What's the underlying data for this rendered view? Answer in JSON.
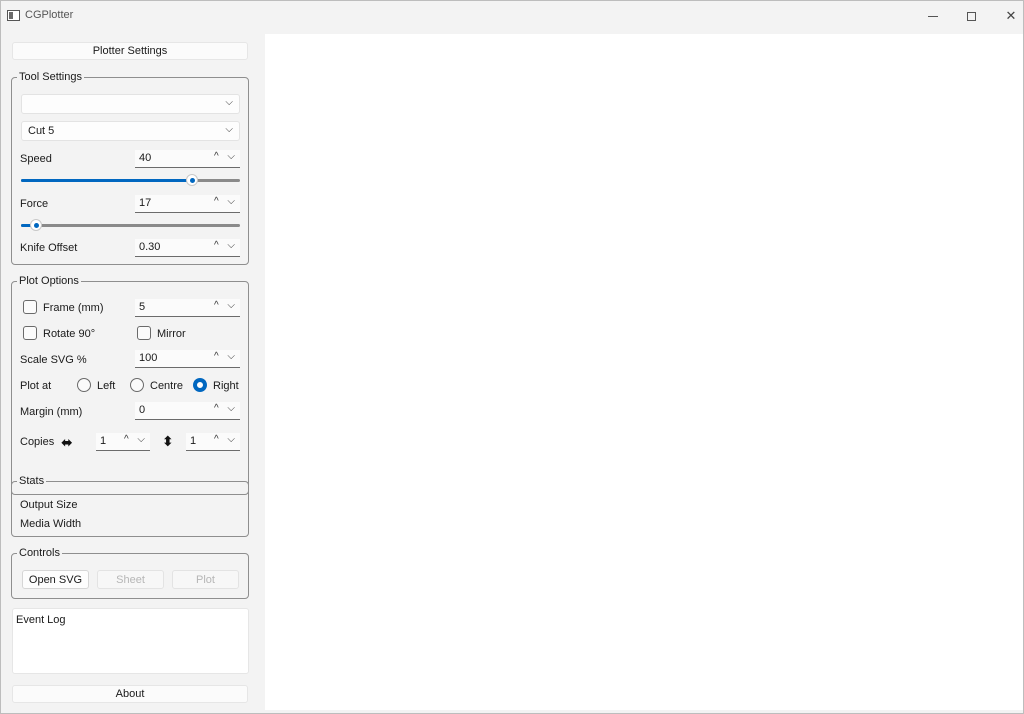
{
  "window": {
    "title": "CGPlotter"
  },
  "plotter_settings_button": "Plotter Settings",
  "tool_settings": {
    "title": "Tool Settings",
    "tool_combo": "",
    "cut_combo": "Cut 5",
    "speed": {
      "label": "Speed",
      "value": "40",
      "level": 0.78
    },
    "force": {
      "label": "Force",
      "value": "17",
      "level": 0.07
    },
    "knife_offset": {
      "label": "Knife Offset",
      "value": "0.30"
    }
  },
  "plot_options": {
    "title": "Plot Options",
    "frame": {
      "label": "Frame (mm)",
      "checked": false,
      "value": "5"
    },
    "rotate": {
      "label": "Rotate 90°",
      "checked": false
    },
    "mirror": {
      "label": "Mirror",
      "checked": false
    },
    "scale": {
      "label": "Scale SVG %",
      "value": "100"
    },
    "plot_at": {
      "label": "Plot at",
      "options": [
        "Left",
        "Centre",
        "Right"
      ],
      "selected": "Right"
    },
    "margin": {
      "label": "Margin (mm)",
      "value": "0"
    },
    "copies": {
      "label": "Copies",
      "horizontal": "1",
      "vertical": "1"
    }
  },
  "stats": {
    "title": "Stats",
    "output_size_label": "Output Size",
    "media_width_label": "Media Width"
  },
  "controls": {
    "title": "Controls",
    "open_svg": "Open SVG",
    "sheet": "Sheet",
    "plot": "Plot"
  },
  "event_log": {
    "label": "Event Log"
  },
  "about_button": "About",
  "colors": {
    "accent": "#0067c0",
    "window_bg": "#f3f3f3",
    "canvas_bg": "#ffffff"
  }
}
